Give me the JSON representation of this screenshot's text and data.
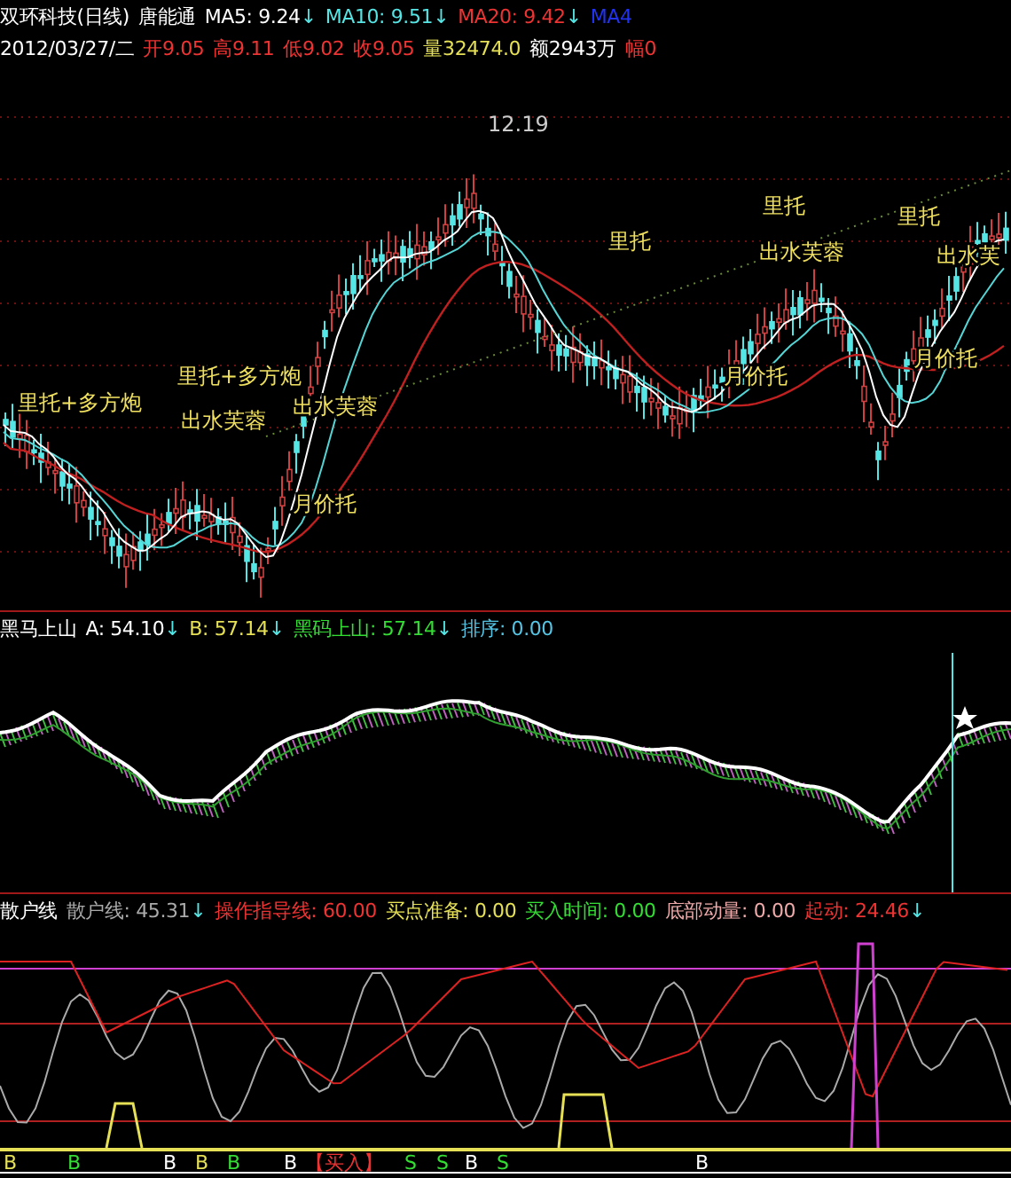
{
  "header": {
    "row1": [
      {
        "text": "双环科技(日线)",
        "color": "#ffffff"
      },
      {
        "text": "唐能通",
        "color": "#ffffff"
      },
      {
        "text": "MA5: 9.24",
        "arrow": "↓",
        "color": "#ffffff"
      },
      {
        "text": "MA10: 9.51",
        "arrow": "↓",
        "color": "#55e5e5"
      },
      {
        "text": "MA20: 9.42",
        "arrow": "↓",
        "color": "#ee3333"
      },
      {
        "text": "MA4",
        "color": "#2233ee"
      }
    ],
    "row2": [
      {
        "text": "2012/03/27/二",
        "color": "#ffffff"
      },
      {
        "text": "开9.05",
        "color": "#ee3333"
      },
      {
        "text": "高9.11",
        "color": "#ee3333"
      },
      {
        "text": "低9.02",
        "color": "#ee3333"
      },
      {
        "text": "收9.05",
        "color": "#ee3333"
      },
      {
        "text": "量32474.0",
        "color": "#e5e055"
      },
      {
        "text": "额2943万",
        "color": "#ffffff"
      },
      {
        "text": "幅0",
        "color": "#ee3333"
      }
    ]
  },
  "main_chart": {
    "high_label": "12.19",
    "annotations": [
      "里托+多方炮",
      "里托+多方炮",
      "出水芙蓉",
      "出水芙蓉",
      "月价托",
      "里托",
      "里托",
      "出水芙蓉",
      "月价托",
      "里托",
      "出水芙",
      "月价托"
    ]
  },
  "panel_2": {
    "items": [
      {
        "text": "黑马上山",
        "color": "#ffffff"
      },
      {
        "text": "A: 54.10",
        "arrow": "↓",
        "color": "#ffffff"
      },
      {
        "text": "B: 57.14",
        "arrow": "↓",
        "color": "#e5e055"
      },
      {
        "text": "黑码上山: 57.14",
        "arrow": "↓",
        "color": "#33dd33"
      },
      {
        "text": "排序: 0.00",
        "color": "#55c5e5"
      }
    ]
  },
  "panel_3": {
    "items": [
      {
        "text": "散户线",
        "color": "#ffffff"
      },
      {
        "text": "散户线: 45.31",
        "arrow": "↓",
        "color": "#aaaaaa"
      },
      {
        "text": "操作指导线: 60.00",
        "color": "#ee3333"
      },
      {
        "text": "买点准备: 0.00",
        "color": "#e5e055"
      },
      {
        "text": "买入时间: 0.00",
        "color": "#33dd33"
      },
      {
        "text": "底部动量: 0.00",
        "color": "#eeaaaa"
      },
      {
        "text": "起动: 24.46",
        "arrow": "↓",
        "color": "#ee3333"
      }
    ],
    "markers": [
      {
        "text": "B",
        "color": "#e5e055"
      },
      {
        "text": "B",
        "color": "#33dd33"
      },
      {
        "text": "B",
        "color": "#ffffff"
      },
      {
        "text": "B",
        "color": "#e5e055"
      },
      {
        "text": "B",
        "color": "#33dd33"
      },
      {
        "text": "B",
        "color": "#ffffff"
      },
      {
        "text": "【买入】",
        "color": "#ee3333"
      },
      {
        "text": "S",
        "color": "#33dd33"
      },
      {
        "text": "S",
        "color": "#33dd33"
      },
      {
        "text": "B",
        "color": "#ffffff"
      },
      {
        "text": "S",
        "color": "#33dd33"
      },
      {
        "text": "B",
        "color": "#ffffff"
      }
    ]
  }
}
